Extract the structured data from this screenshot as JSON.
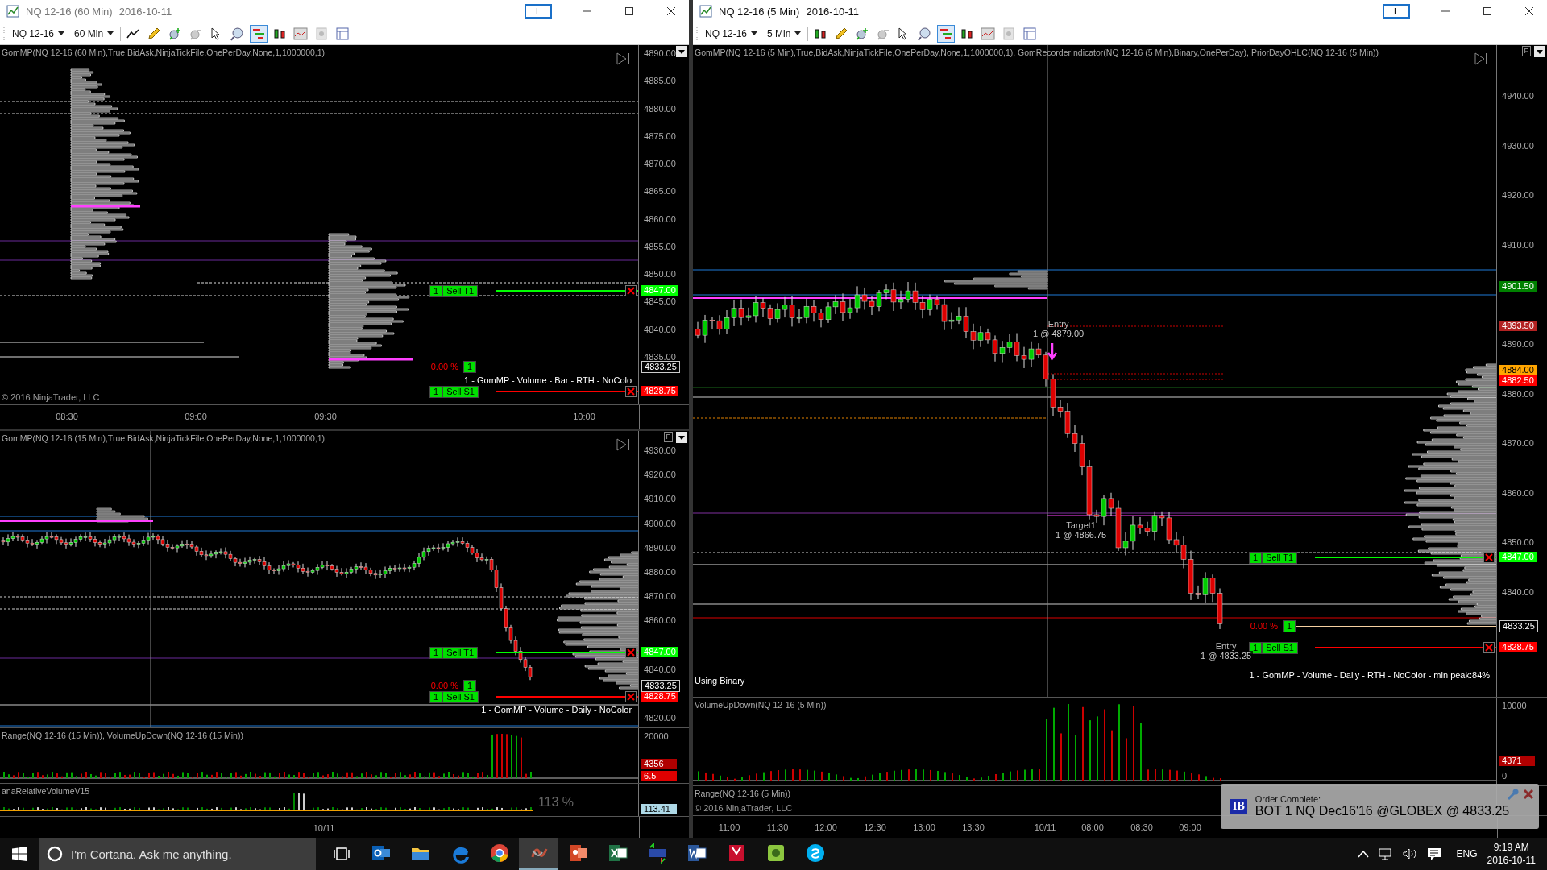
{
  "windows": [
    {
      "title": "NQ 12-16 (60 Min)",
      "date": "2016-10-11",
      "active": false,
      "layout_button": "L",
      "instrument": "NQ 12-16",
      "interval": "60 Min",
      "tools": [
        {
          "kind": "line",
          "selected": false
        },
        {
          "kind": "pencil",
          "selected": false
        },
        {
          "kind": "zoom-in",
          "selected": false
        },
        {
          "kind": "zoom-out",
          "selected": false
        },
        {
          "kind": "pointer",
          "selected": false
        },
        {
          "kind": "magnifier",
          "selected": false
        },
        {
          "kind": "bars",
          "selected": true
        },
        {
          "kind": "candles",
          "selected": false
        },
        {
          "kind": "chart",
          "selected": false
        },
        {
          "kind": "dollar",
          "selected": false
        },
        {
          "kind": "table",
          "selected": false
        }
      ],
      "charts": [
        {
          "time_ticks": [
            "08:30",
            "09:00",
            "09:30",
            "10:00"
          ],
          "panes": [
            {
              "kind": "price",
              "legend": "GomMP(NQ 12-16 (60 Min),True,BidAsk,NinjaTickFile,OnePerDay,None,1,1000000,1)",
              "y_ticks": [
                "4890.00",
                "4885.00",
                "4880.00",
                "4875.00",
                "4870.00",
                "4865.00",
                "4860.00",
                "4855.00",
                "4850.00",
                "4845.00",
                "4840.00",
                "4835.00"
              ],
              "orders": [
                {
                  "qty": "1",
                  "label": "Sell T1",
                  "price": "4847.00",
                  "color": "#00ff00"
                },
                {
                  "qty": "1",
                  "label": "Sell S1",
                  "price": "4828.75",
                  "color": "#ff0000"
                }
              ],
              "position": {
                "percent": "0.00 %",
                "qty": "1",
                "price": "4833.25"
              },
              "strategy": "1 - GomMP - Volume - Bar - RTH - NoColo",
              "copyright": "© 2016 NinjaTrader, LLC"
            }
          ]
        },
        {
          "time_ticks": [
            "10/11"
          ],
          "panes": [
            {
              "kind": "price",
              "menu_label": "F",
              "legend": "GomMP(NQ 12-16 (15 Min),True,BidAsk,NinjaTickFile,OnePerDay,None,1,1000000,1)",
              "y_ticks": [
                "4930.00",
                "4920.00",
                "4910.00",
                "4900.00",
                "4890.00",
                "4880.00",
                "4870.00",
                "4860.00",
                "4840.00",
                "4820.00"
              ],
              "orders": [
                {
                  "qty": "1",
                  "label": "Sell T1",
                  "price": "4847.00",
                  "color": "#00ff00"
                },
                {
                  "qty": "1",
                  "label": "Sell S1",
                  "price": "4828.75",
                  "color": "#ff0000"
                }
              ],
              "position": {
                "percent": "0.00 %",
                "qty": "1",
                "price": "4833.25"
              },
              "strategy": "1 - GomMP - Volume - Daily - NoColor"
            },
            {
              "kind": "volume",
              "legend": "Range(NQ 12-16 (15 Min)), VolumeUpDown(NQ 12-16 (15 Min))",
              "y_ticks": [
                "20000"
              ],
              "tags": [
                {
                  "text": "4356",
                  "color": "#b00000"
                },
                {
                  "text": "6.5",
                  "color": "#e00000"
                }
              ]
            },
            {
              "kind": "relvol",
              "legend": "anaRelativeVolumeV15",
              "reading": "113 %",
              "tags": [
                {
                  "text": "113.41",
                  "color": "#add8e6"
                }
              ]
            }
          ]
        }
      ]
    },
    {
      "title": "NQ 12-16 (5 Min)",
      "date": "2016-10-11",
      "active": true,
      "layout_button": "L",
      "instrument": "NQ 12-16",
      "interval": "5 Min",
      "tools": [
        {
          "kind": "candles",
          "selected": false
        },
        {
          "kind": "pencil",
          "selected": false
        },
        {
          "kind": "zoom-in",
          "selected": false
        },
        {
          "kind": "zoom-out",
          "selected": false
        },
        {
          "kind": "pointer",
          "selected": false
        },
        {
          "kind": "magnifier",
          "selected": false
        },
        {
          "kind": "bars",
          "selected": true
        },
        {
          "kind": "candles",
          "selected": false
        },
        {
          "kind": "chart",
          "selected": false
        },
        {
          "kind": "dollar",
          "selected": false
        },
        {
          "kind": "table",
          "selected": false
        }
      ],
      "charts": [
        {
          "time_ticks": [
            "11:00",
            "11:30",
            "12:00",
            "12:30",
            "13:00",
            "13:30",
            "10/11",
            "08:00",
            "08:30",
            "09:00"
          ],
          "panes": [
            {
              "kind": "price",
              "menu_label": "F",
              "legend": "GomMP(NQ 12-16 (5 Min),True,BidAsk,NinjaTickFile,OnePerDay,None,1,1000000,1), GomRecorderIndicator(NQ 12-16 (5 Min),Binary,OnePerDay), PriorDayOHLC(NQ 12-16 (5 Min))",
              "y_ticks": [
                "4940.00",
                "4930.00",
                "4920.00",
                "4910.00",
                "4890.00",
                "4880.00",
                "4870.00",
                "4860.00",
                "4850.00",
                "4840.00"
              ],
              "tags": [
                {
                  "text": "4901.50",
                  "color": "#008000"
                },
                {
                  "text": "4893.50",
                  "color": "#b22222"
                },
                {
                  "text": "4884.00",
                  "color": "#ffa500"
                },
                {
                  "text": "4882.50",
                  "color": "#ff0000"
                }
              ],
              "orders": [
                {
                  "qty": "1",
                  "label": "Sell T1",
                  "price": "4847.00",
                  "color": "#00ff00"
                },
                {
                  "qty": "1",
                  "label": "Sell S1",
                  "price": "4828.75",
                  "color": "#ff0000"
                }
              ],
              "position": {
                "percent": "0.00 %",
                "qty": "1",
                "price": "4833.25"
              },
              "strategy": "1 - GomMP - Volume - Daily - RTH - NoColor - min peak:84%",
              "notes": [
                {
                  "title": "Entry",
                  "detail": "1 @ 4879.00"
                },
                {
                  "title": "Target1",
                  "detail": "1 @ 4866.75"
                },
                {
                  "title": "Entry",
                  "detail": "1 @ 4833.25"
                }
              ],
              "caption": "Using Binary"
            },
            {
              "kind": "volume",
              "legend": "VolumeUpDown(NQ 12-16 (5 Min))",
              "y_ticks": [
                "10000",
                "0"
              ],
              "tags": [
                {
                  "text": "4371",
                  "color": "#b00000"
                }
              ]
            },
            {
              "kind": "range",
              "legend": "Range(NQ 12-16 (5 Min))",
              "copyright": "© 2016 NinjaTrader, LLC"
            }
          ]
        }
      ]
    }
  ],
  "notification": {
    "logo": "IB",
    "heading": "Order Complete:",
    "message": "BOT 1 NQ Dec16'16 @GLOBEX @ 4833.25"
  },
  "taskbar": {
    "search_placeholder": "I'm Cortana. Ask me anything.",
    "apps": [
      {
        "kind": "mail",
        "selected": false
      },
      {
        "kind": "folder",
        "selected": false
      },
      {
        "kind": "browser-e",
        "selected": false
      },
      {
        "kind": "browser-round",
        "selected": false
      },
      {
        "kind": "ninja",
        "selected": true
      },
      {
        "kind": "slides",
        "selected": false
      },
      {
        "kind": "sheet",
        "selected": false
      },
      {
        "kind": "tws",
        "selected": false
      },
      {
        "kind": "doc",
        "selected": false
      },
      {
        "kind": "book",
        "selected": false
      },
      {
        "kind": "emblem",
        "selected": false
      },
      {
        "kind": "chat",
        "selected": false
      }
    ],
    "language": "ENG",
    "time": "9:19 AM",
    "date": "2016-10-11"
  }
}
